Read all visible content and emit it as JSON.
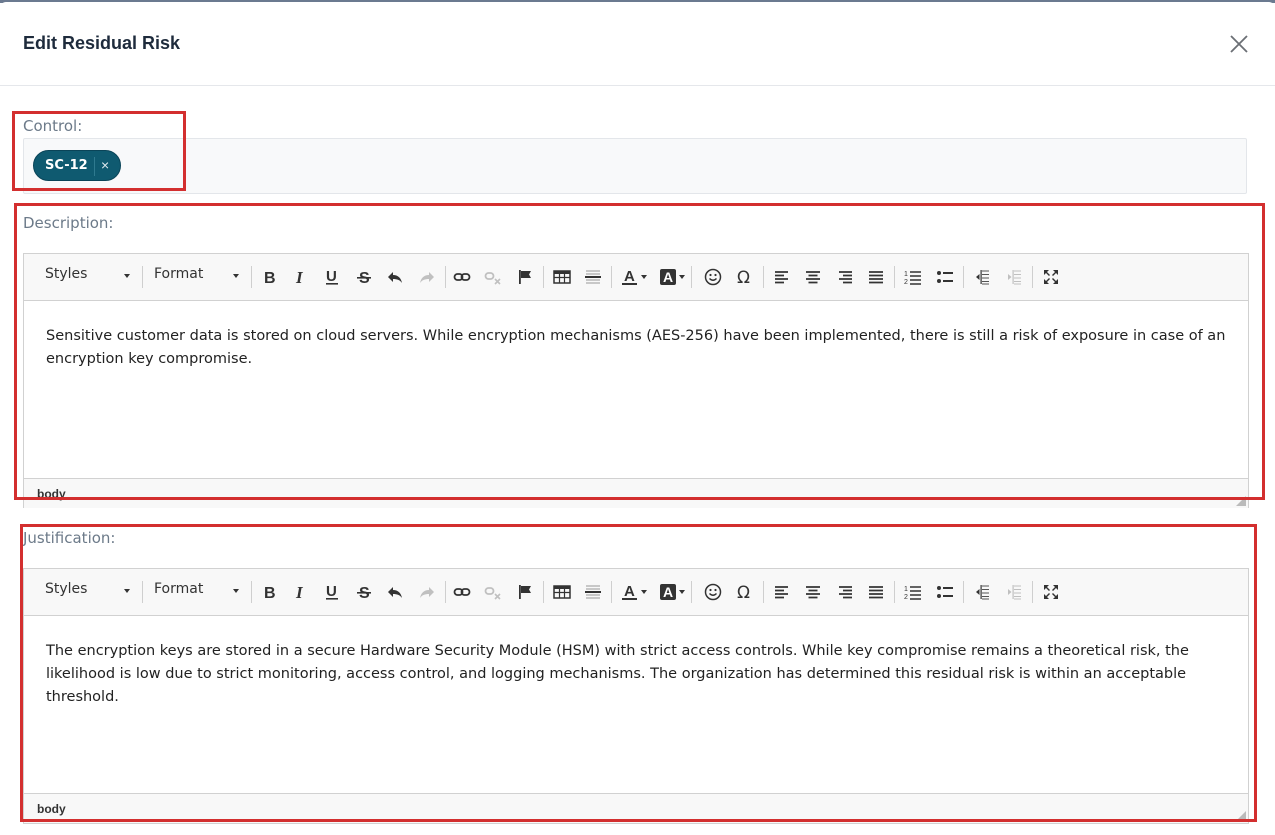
{
  "modal": {
    "title": "Edit Residual Risk"
  },
  "control": {
    "label": "Control:",
    "chips": [
      {
        "text": "SC-12",
        "remove": "×"
      }
    ]
  },
  "description": {
    "label": "Description:",
    "text": "Sensitive customer data is stored on cloud servers. While encryption mechanisms (AES-256) have been implemented, there is still a risk of exposure in case of an encryption key compromise.",
    "path": "body"
  },
  "justification": {
    "label": "Justification:",
    "text": "The encryption keys are stored in a secure Hardware Security Module (HSM) with strict access controls. While key compromise remains a theoretical risk, the likelihood is low due to strict monitoring, access control, and logging mechanisms. The organization has determined this residual risk is within an acceptable threshold.",
    "path": "body"
  },
  "toolbar": {
    "styles_label": "Styles",
    "format_label": "Format"
  },
  "colors": {
    "chip": "#0f5a70",
    "highlight": "#d32f2f",
    "title": "#1e2b3c",
    "label": "#6c7a89"
  }
}
